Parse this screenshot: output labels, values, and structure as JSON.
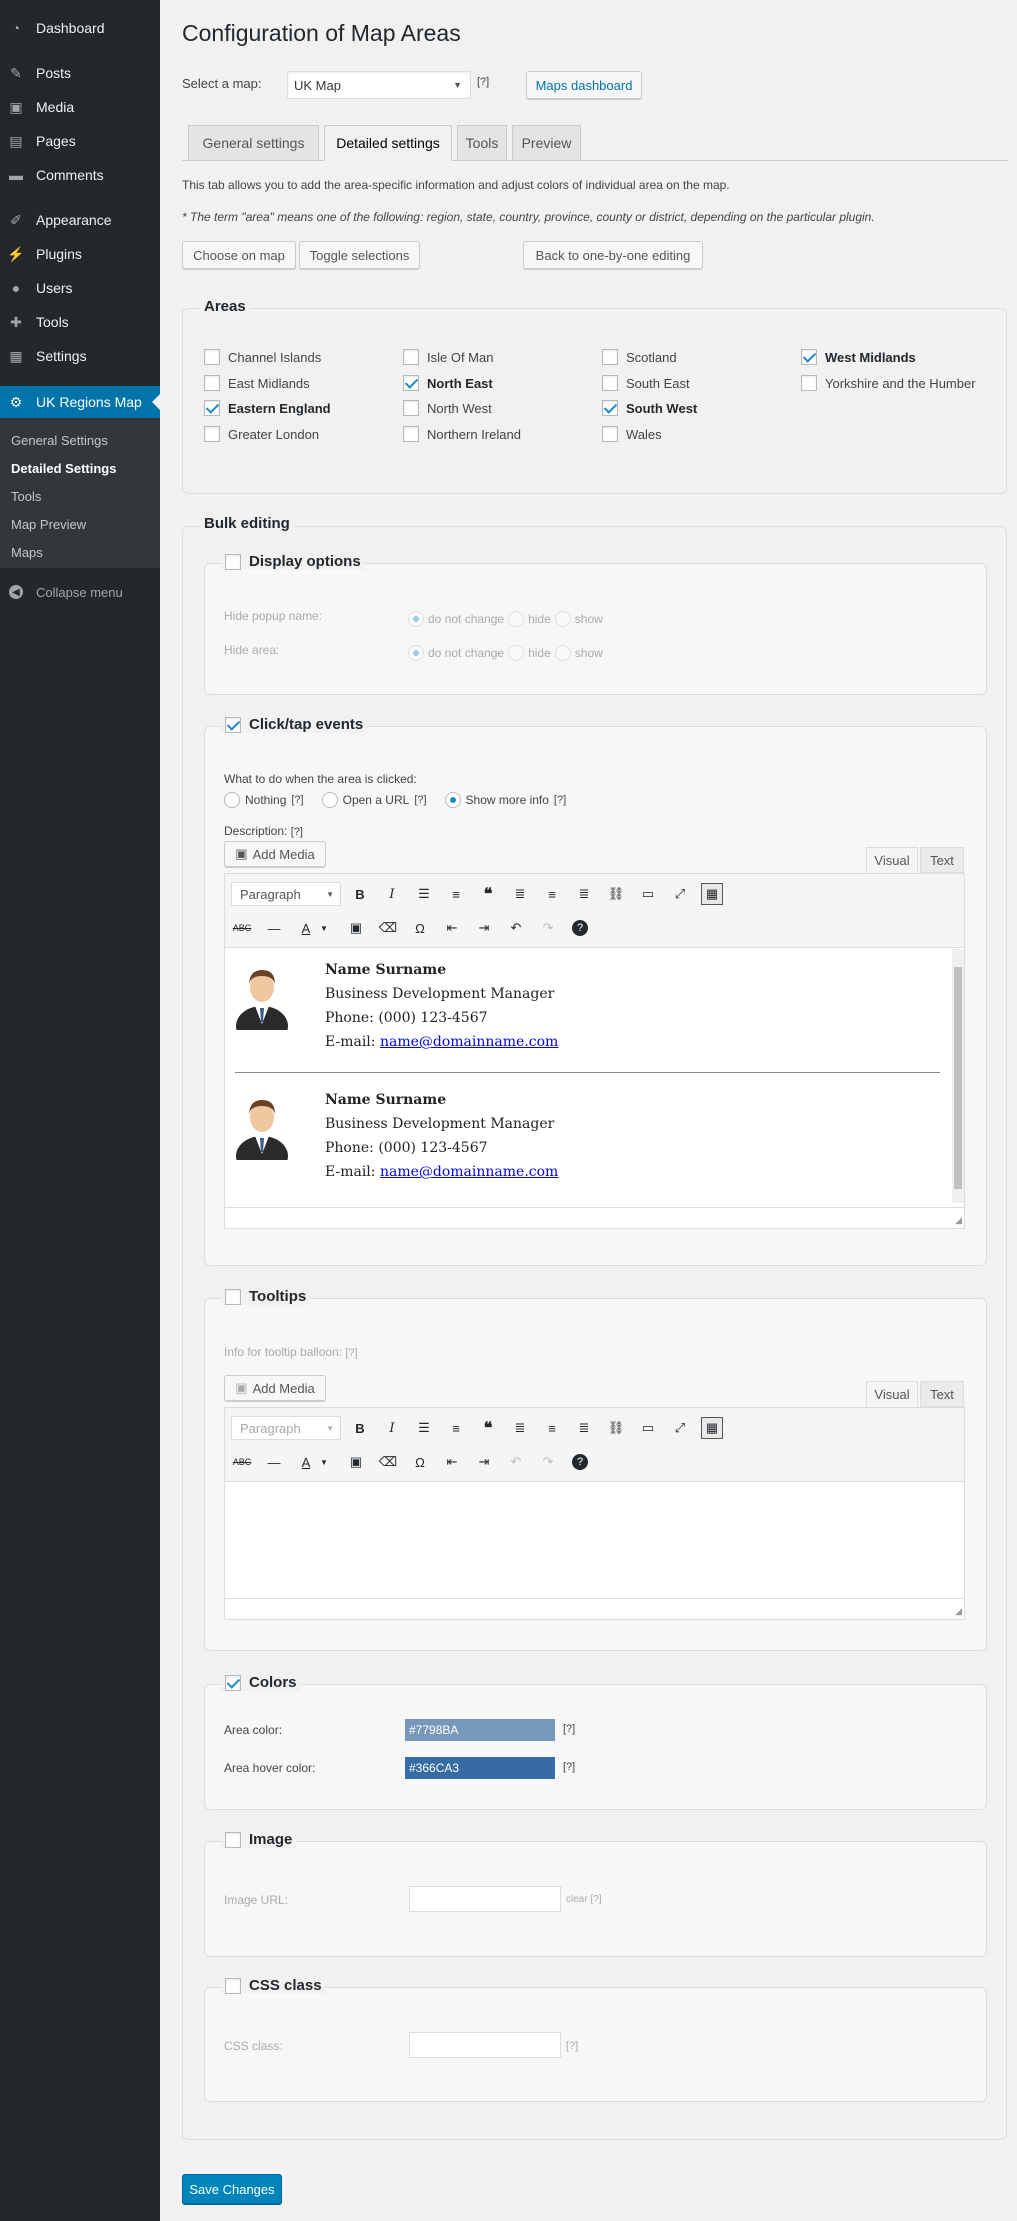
{
  "sidebar": {
    "items": [
      {
        "label": "Dashboard",
        "icon": "dashboard-icon"
      },
      {
        "label": "Posts",
        "icon": "pin-icon"
      },
      {
        "label": "Media",
        "icon": "media-icon"
      },
      {
        "label": "Pages",
        "icon": "pages-icon"
      },
      {
        "label": "Comments",
        "icon": "comments-icon"
      },
      {
        "label": "Appearance",
        "icon": "brush-icon"
      },
      {
        "label": "Plugins",
        "icon": "plugin-icon"
      },
      {
        "label": "Users",
        "icon": "users-icon"
      },
      {
        "label": "Tools",
        "icon": "wrench-icon"
      },
      {
        "label": "Settings",
        "icon": "settings-icon"
      },
      {
        "label": "UK Regions Map",
        "icon": "gear-icon"
      }
    ],
    "submenu": [
      "General Settings",
      "Detailed Settings",
      "Tools",
      "Map Preview",
      "Maps"
    ],
    "collapse_label": "Collapse menu"
  },
  "header": {
    "title": "Configuration of Map Areas",
    "select_label": "Select a map:",
    "select_value": "UK Map",
    "help": "[?]",
    "dashboard_button": "Maps dashboard"
  },
  "tabs": [
    "General settings",
    "Detailed settings",
    "Tools",
    "Preview"
  ],
  "intro": {
    "line1": "This tab allows you to add the area-specific information and adjust colors of individual area on the map.",
    "line2": "* The term \"area\" means one of the following: region, state, country, province, county or district, depending on the particular plugin."
  },
  "actions": {
    "choose": "Choose on map",
    "toggle": "Toggle selections",
    "back": "Back to one-by-one editing"
  },
  "areas": {
    "legend": "Areas",
    "items": [
      {
        "label": "Channel Islands",
        "checked": false
      },
      {
        "label": "East Midlands",
        "checked": false
      },
      {
        "label": "Eastern England",
        "checked": true
      },
      {
        "label": "Greater London",
        "checked": false
      },
      {
        "label": "Isle Of Man",
        "checked": false
      },
      {
        "label": "North East",
        "checked": true
      },
      {
        "label": "North West",
        "checked": false
      },
      {
        "label": "Northern Ireland",
        "checked": false
      },
      {
        "label": "Scotland",
        "checked": false
      },
      {
        "label": "South East",
        "checked": false
      },
      {
        "label": "South West",
        "checked": true
      },
      {
        "label": "Wales",
        "checked": false
      },
      {
        "label": "West Midlands",
        "checked": true
      },
      {
        "label": "Yorkshire and the Humber",
        "checked": false
      }
    ]
  },
  "bulk": {
    "legend": "Bulk editing",
    "display": {
      "legend": "Display options",
      "hide_popup": "Hide popup name:",
      "hide_area": "Hide area:",
      "opt_nochange": "do not change",
      "opt_hide": "hide",
      "opt_show": "show"
    },
    "click": {
      "legend": "Click/tap events",
      "question": "What to do when the area is clicked:",
      "opt_nothing": "Nothing",
      "opt_url": "Open a URL",
      "opt_more": "Show more info",
      "help": "[?]",
      "description": "Description:",
      "add_media": "Add Media",
      "visual": "Visual",
      "text": "Text",
      "paragraph": "Paragraph",
      "cards": [
        {
          "name": "Name Surname",
          "title": "Business Development Manager",
          "phone": "Phone: (000) 123-4567",
          "email_prefix": "E-mail:",
          "email": "name@domainname.com"
        },
        {
          "name": "Name Surname",
          "title": "Business Development Manager",
          "phone": "Phone: (000) 123-4567",
          "email_prefix": "E-mail:",
          "email": "name@domainname.com"
        }
      ]
    },
    "tooltips": {
      "legend": "Tooltips",
      "info": "Info for tooltip balloon:",
      "help": "[?]",
      "add_media": "Add Media",
      "visual": "Visual",
      "text": "Text",
      "paragraph": "Paragraph"
    },
    "colors": {
      "legend": "Colors",
      "area_label": "Area color:",
      "area_value": "#7798BA",
      "hover_label": "Area hover color:",
      "hover_value": "#366CA3",
      "help": "[?]"
    },
    "image": {
      "legend": "Image",
      "url_label": "Image URL:",
      "clear": "clear",
      "help": "[?]"
    },
    "css": {
      "legend": "CSS class",
      "label": "CSS class:",
      "help": "[?]"
    }
  },
  "save": "Save Changes"
}
